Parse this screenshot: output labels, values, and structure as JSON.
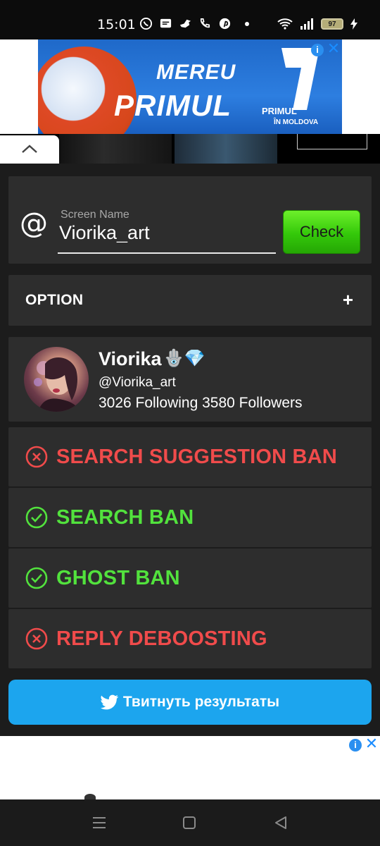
{
  "status_bar": {
    "time": "15:01",
    "battery": "97",
    "icons": [
      "viber-icon",
      "message-icon",
      "bird-icon",
      "phone-icon",
      "pinterest-icon",
      "dot-icon",
      "wifi-icon",
      "signal-icon",
      "battery-icon",
      "charging-icon"
    ]
  },
  "ad_top": {
    "line1": "MEREU",
    "line2": "PRIMUL",
    "brand": "PRIMUL",
    "brand_sub": "ÎN MOLDOVA",
    "info": "i",
    "close": "✕"
  },
  "search": {
    "at": "@",
    "label": "Screen Name",
    "value": "Viorika_art",
    "check_label": "Check"
  },
  "option": {
    "label": "OPTION",
    "toggle": "+"
  },
  "profile": {
    "name": "Viorika",
    "emoji": "🪬💎",
    "handle": "@Viorika_art",
    "stats": "3026 Following 3580 Followers"
  },
  "results": [
    {
      "label": "SEARCH SUGGESTION BAN",
      "status": "ban"
    },
    {
      "label": "SEARCH BAN",
      "status": "ok"
    },
    {
      "label": "GHOST BAN",
      "status": "ok"
    },
    {
      "label": "REPLY DEBOOSTING",
      "status": "ban"
    }
  ],
  "tweet": {
    "label": "Твитнуть результаты"
  },
  "ad_bottom": {
    "info": "i",
    "close": "✕"
  },
  "colors": {
    "ban": "#f04b4b",
    "ok": "#52e23d",
    "check_button": "#3fd311",
    "tweet_button": "#1ca5ee",
    "panel": "#2d2d2d"
  }
}
